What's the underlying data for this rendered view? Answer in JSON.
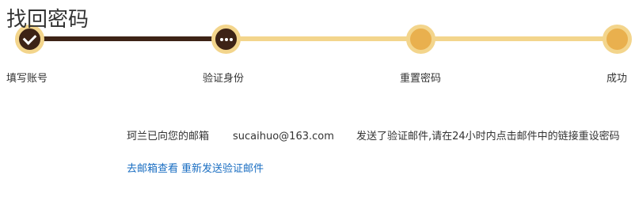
{
  "page": {
    "title": "找回密码"
  },
  "steps": [
    {
      "label": "填写账号",
      "status": "done",
      "icon": "check-icon"
    },
    {
      "label": "验证身份",
      "status": "current",
      "icon": "more-dots-icon"
    },
    {
      "label": "重置密码",
      "status": "pending",
      "icon": ""
    },
    {
      "label": "成功",
      "status": "pending",
      "icon": ""
    }
  ],
  "message": {
    "prefix": "珂兰已向您的邮箱",
    "email": "sucaihuo@163.com",
    "suffix": "发送了验证邮件,请在24小时内点击邮件中的链接重设密码"
  },
  "links": {
    "check_mailbox": "去邮箱查看",
    "resend": "重新发送验证邮件"
  },
  "colors": {
    "done_track": "#3d2316",
    "pending_track": "#f3d58c",
    "pending_node": "#e9b04e",
    "link": "#1a6ec2"
  }
}
